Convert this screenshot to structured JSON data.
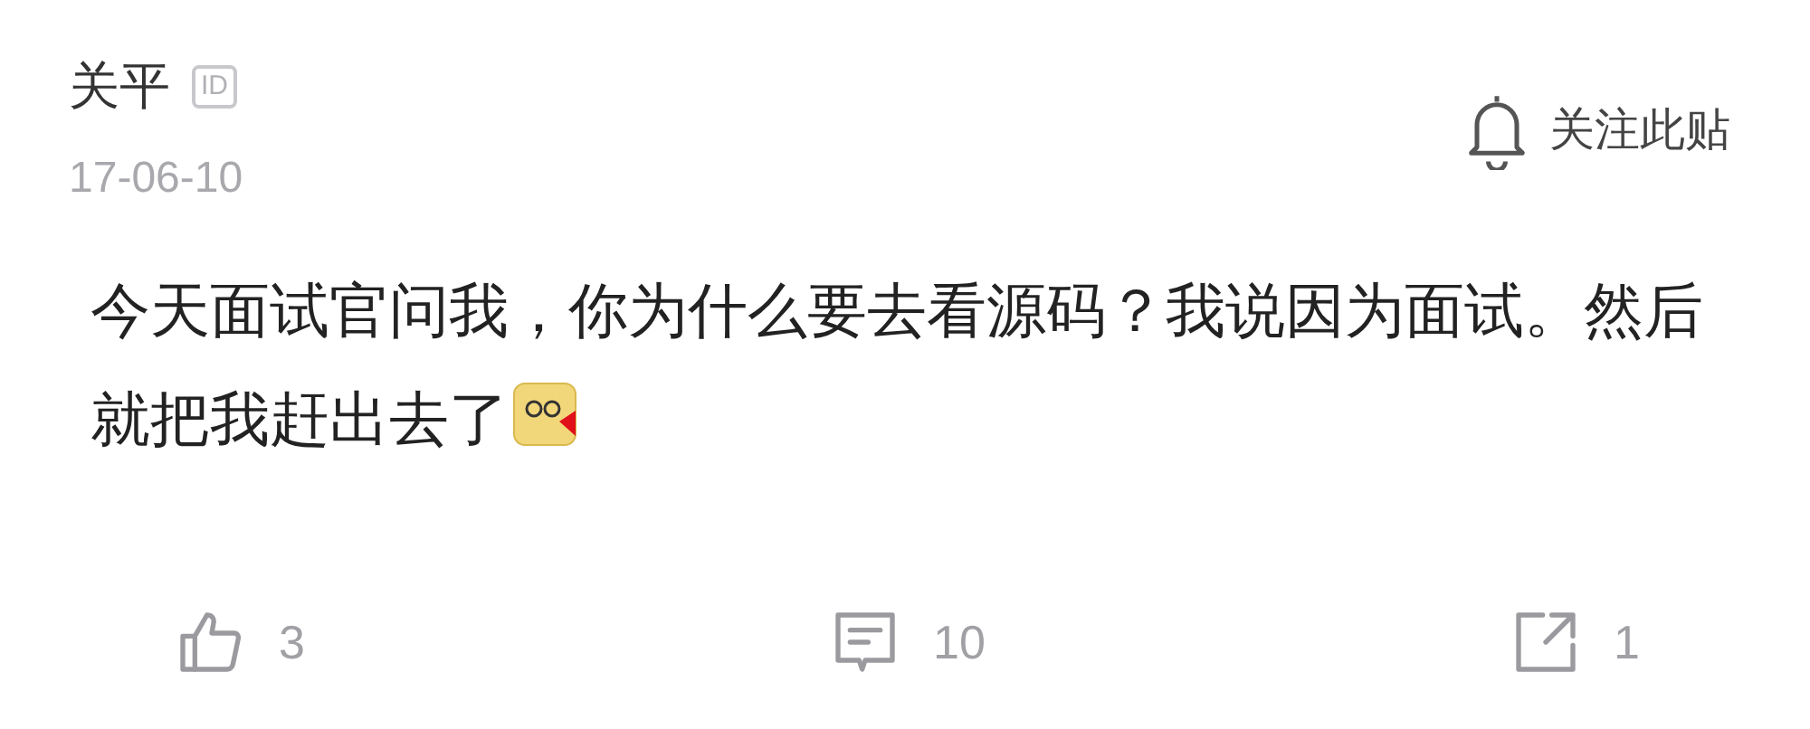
{
  "author": {
    "name": "关平",
    "badge": "ID"
  },
  "date": "17-06-10",
  "follow": {
    "label": "关注此贴"
  },
  "body": {
    "text": "今天面试官问我，你为什么要去看源码？我说因为面试。然后就把我赶出去了"
  },
  "actions": [
    {
      "kind": "like",
      "count": "3"
    },
    {
      "kind": "comment",
      "count": "10"
    },
    {
      "kind": "share",
      "count": "1"
    }
  ]
}
